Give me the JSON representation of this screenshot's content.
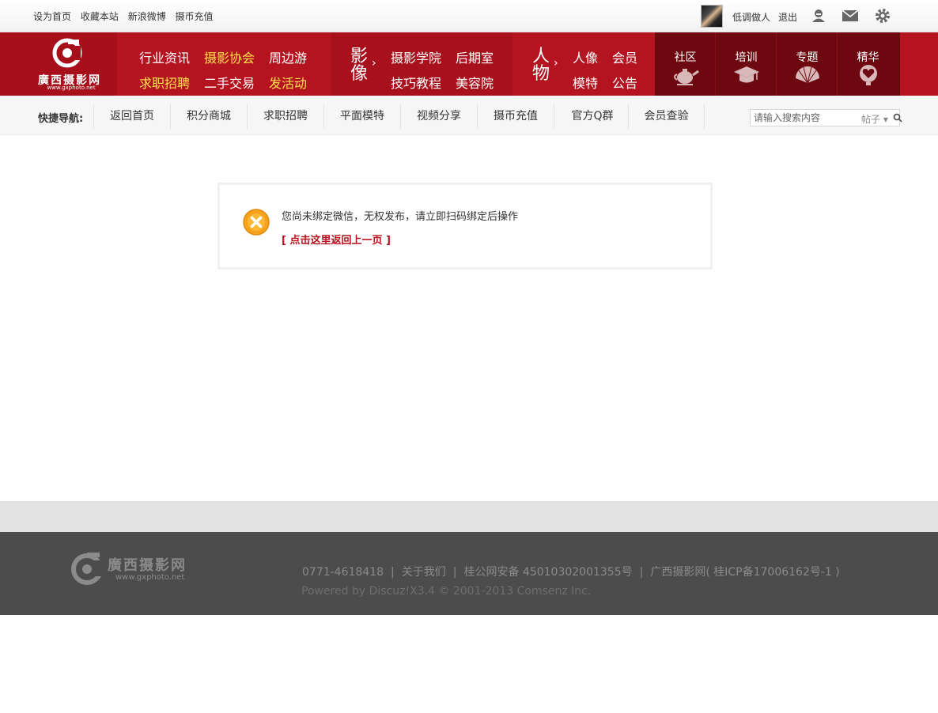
{
  "topbar": {
    "links": [
      "设为首页",
      "收藏本站",
      "新浪微博",
      "摄币充值"
    ],
    "username": "低调做人",
    "logout": "退出"
  },
  "logo": {
    "name": "廣西摄影网",
    "url": "www.gxphoto.net"
  },
  "nav": {
    "group1": {
      "row1": [
        {
          "label": "行业资讯",
          "highlight": false
        },
        {
          "label": "摄影协会",
          "highlight": true
        },
        {
          "label": "周边游",
          "highlight": false
        }
      ],
      "row2": [
        {
          "label": "求职招聘",
          "highlight": true
        },
        {
          "label": "二手交易",
          "highlight": false
        },
        {
          "label": "发活动",
          "highlight": true
        }
      ]
    },
    "group2": {
      "title_top": "影",
      "title_bottom": "像",
      "items": [
        "摄影学院",
        "后期室",
        "技巧教程",
        "美容院"
      ]
    },
    "group3": {
      "title_top": "人",
      "title_bottom": "物",
      "items": [
        "人像",
        "会员",
        "模特",
        "公告"
      ]
    },
    "features": [
      {
        "label": "社区",
        "icon": "teapot-icon"
      },
      {
        "label": "培训",
        "icon": "graduation-cap-icon"
      },
      {
        "label": "专题",
        "icon": "fan-icon"
      },
      {
        "label": "精华",
        "icon": "heart-icon"
      }
    ]
  },
  "quicknav": {
    "title": "快捷导航:",
    "items": [
      "返回首页",
      "积分商城",
      "求职招聘",
      "平面模特",
      "视频分享",
      "摄币充值",
      "官方Q群",
      "会员查验"
    ],
    "search_placeholder": "请输入搜索内容",
    "search_type": "帖子"
  },
  "message": {
    "text": "您尚未绑定微信，无权发布，请立即扫码绑定后操作",
    "back_link": "[ 点击这里返回上一页 ]"
  },
  "footer": {
    "phone": "0771-4618418",
    "about": "关于我们",
    "police": "桂公网安备 45010302001355号",
    "icp": "广西摄影网( 桂ICP备17006162号-1 )",
    "powered": "Powered by Discuz!X3.4 © 2001-2013 Comsenz Inc."
  },
  "colors": {
    "brand_red": "#b5131f",
    "dark_red": "#6e0810",
    "highlight_yellow": "#ffe04a",
    "link_red": "#b8101d"
  }
}
